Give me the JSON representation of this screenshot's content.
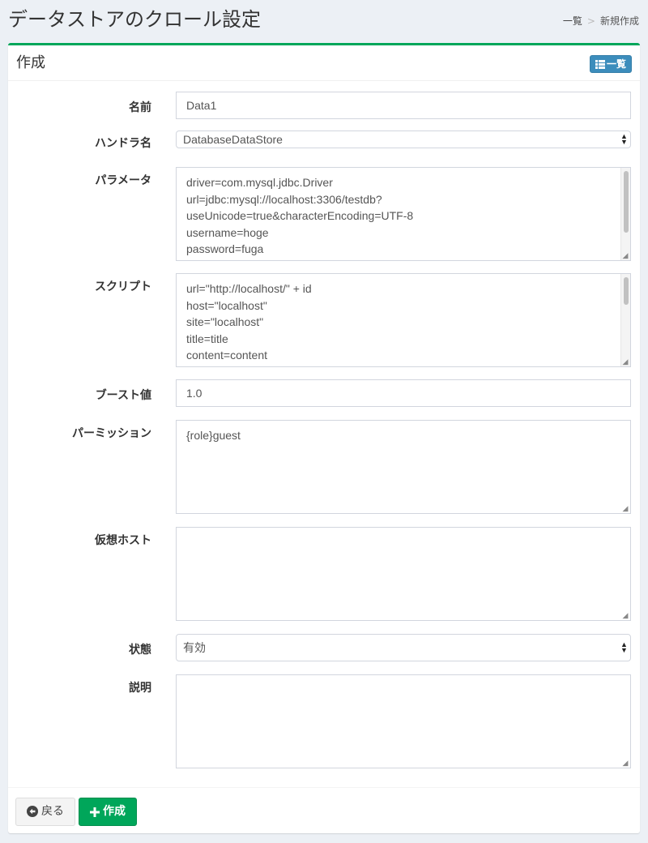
{
  "header": {
    "title": "データストアのクロール設定",
    "breadcrumb": {
      "list": "一覧",
      "separator": ">",
      "current": "新規作成"
    }
  },
  "box": {
    "title": "作成",
    "list_button_label": "一覧"
  },
  "form": {
    "name": {
      "label": "名前",
      "value": "Data1"
    },
    "handler": {
      "label": "ハンドラ名",
      "value": "DatabaseDataStore"
    },
    "parameters": {
      "label": "パラメータ",
      "lines": [
        "driver=com.mysql.jdbc.Driver",
        "url=jdbc:mysql://localhost:3306/testdb?",
        "useUnicode=true&characterEncoding=UTF-8",
        "username=hoge",
        "password=fuga"
      ]
    },
    "script": {
      "label": "スクリプト",
      "lines": [
        "url=\"http://localhost/\" + id",
        "host=\"localhost\"",
        "site=\"localhost\"",
        "title=title",
        "content=content"
      ]
    },
    "boost": {
      "label": "ブースト値",
      "value": "1.0"
    },
    "permissions": {
      "label": "パーミッション",
      "value": "{role}guest"
    },
    "virtual_host": {
      "label": "仮想ホスト",
      "value": ""
    },
    "status": {
      "label": "状態",
      "value": "有効"
    },
    "description": {
      "label": "説明",
      "value": ""
    }
  },
  "footer": {
    "back_label": "戻る",
    "create_label": "作成"
  },
  "colors": {
    "accent_green": "#00a65a",
    "accent_blue": "#3c8dbc",
    "background": "#ecf0f5"
  }
}
